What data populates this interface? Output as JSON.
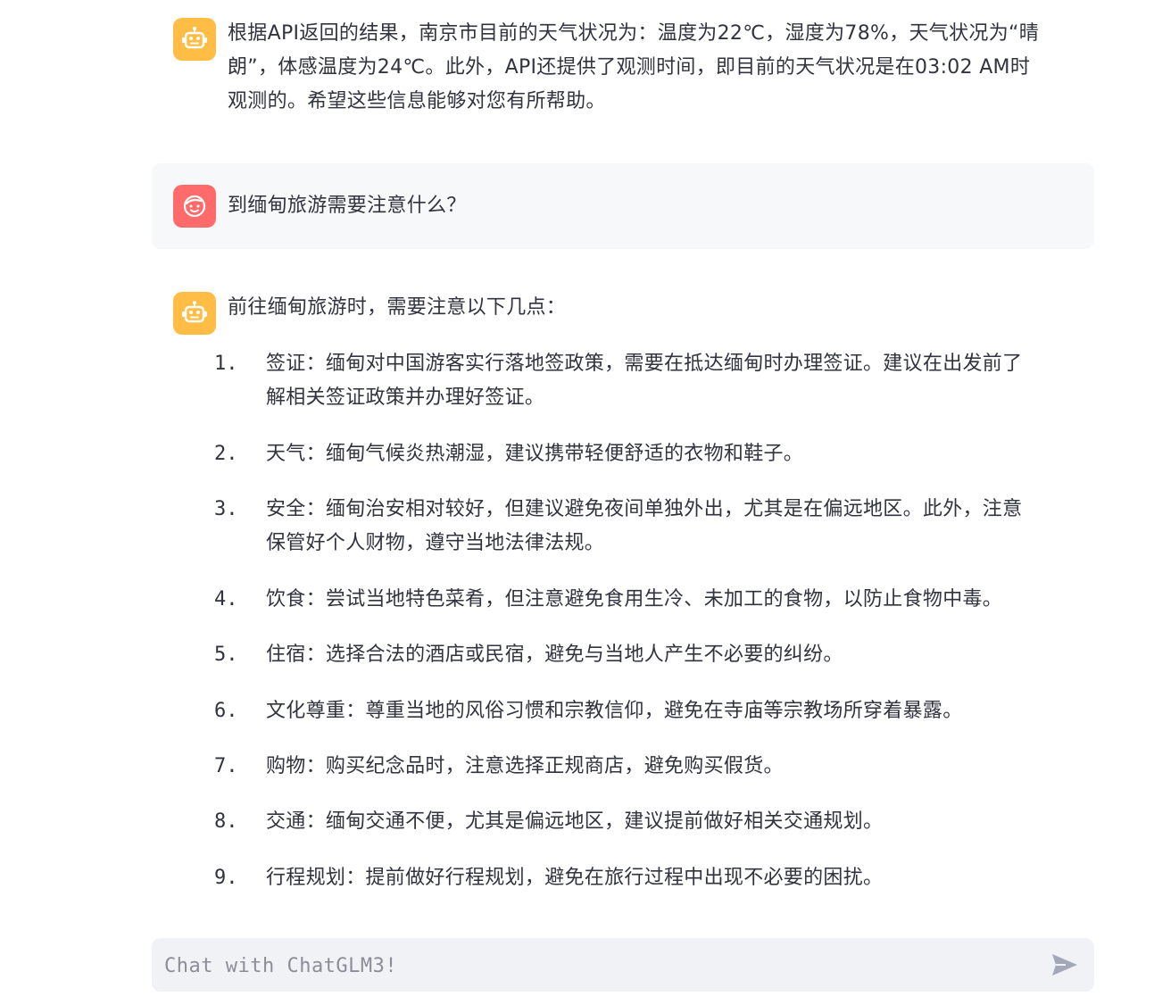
{
  "messages": [
    {
      "role": "assistant",
      "avatar_icon": "robot-icon",
      "lines": [
        "根据API返回的结果，南京市目前的天气状况为：温度为22℃，湿度为78%，天气状况为“晴",
        "朗”，体感温度为24℃。此外，API还提供了观测时间，即目前的天气状况是在03:02 AM时",
        "观测的。希望这些信息能够对您有所帮助。"
      ]
    },
    {
      "role": "user",
      "avatar_icon": "smiley-face-icon",
      "text": "到缅甸旅游需要注意什么？"
    },
    {
      "role": "assistant",
      "avatar_icon": "robot-icon",
      "intro": "前往缅甸旅游时，需要注意以下几点：",
      "items": [
        {
          "num": "1.",
          "lines": [
            "签证：缅甸对中国游客实行落地签政策，需要在抵达缅甸时办理签证。建议在出发前了",
            "解相关签证政策并办理好签证。"
          ]
        },
        {
          "num": "2.",
          "lines": [
            "天气：缅甸气候炎热潮湿，建议携带轻便舒适的衣物和鞋子。"
          ]
        },
        {
          "num": "3.",
          "lines": [
            "安全：缅甸治安相对较好，但建议避免夜间单独外出，尤其是在偏远地区。此外，注意",
            "保管好个人财物，遵守当地法律法规。"
          ]
        },
        {
          "num": "4.",
          "lines": [
            "饮食：尝试当地特色菜肴，但注意避免食用生冷、未加工的食物，以防止食物中毒。"
          ]
        },
        {
          "num": "5.",
          "lines": [
            "住宿：选择合法的酒店或民宿，避免与当地人产生不必要的纠纷。"
          ]
        },
        {
          "num": "6.",
          "lines": [
            "文化尊重：尊重当地的风俗习惯和宗教信仰，避免在寺庙等宗教场所穿着暴露。"
          ]
        },
        {
          "num": "7.",
          "lines": [
            "购物：购买纪念品时，注意选择正规商店，避免购买假货。"
          ]
        },
        {
          "num": "8.",
          "lines": [
            "交通：缅甸交通不便，尤其是偏远地区，建议提前做好相关交通规划。"
          ]
        },
        {
          "num": "9.",
          "lines": [
            "行程规划：提前做好行程规划，避免在旅行过程中出现不必要的困扰。"
          ]
        }
      ]
    }
  ],
  "chat_input": {
    "placeholder": "Chat with ChatGLM3!",
    "value": "",
    "send_icon": "send-arrow-icon"
  },
  "colors": {
    "bot_avatar": "#ffbd45",
    "user_avatar": "#ff6b6b",
    "user_bubble": "#f7f8fa",
    "input_bg": "#f0f2f6",
    "text": "#31333f",
    "placeholder": "#8a8e98"
  }
}
